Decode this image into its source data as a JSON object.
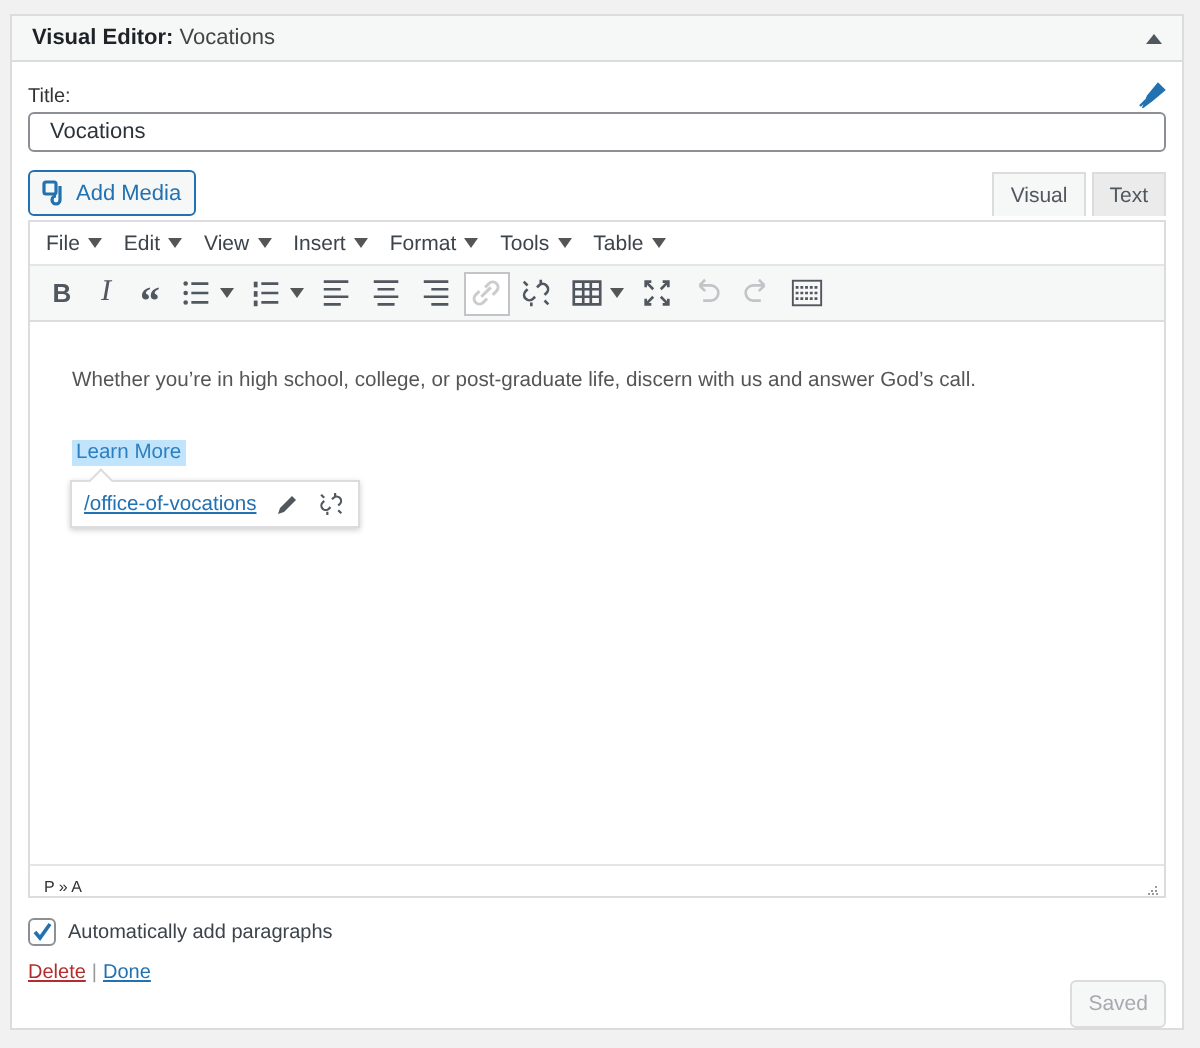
{
  "panel": {
    "title": "**Visual Editor:** Vocations",
    "expanded": true
  },
  "title_field": {
    "label": "Title:",
    "value": "Vocations"
  },
  "add_media": "Add Media",
  "editor_tabs": [
    {
      "label": "Visual",
      "selected": true
    },
    {
      "label": "Text",
      "selected": false
    }
  ],
  "menu": [
    "File",
    "Edit",
    "View",
    "Insert",
    "Format",
    "Tools",
    "Table"
  ],
  "toolbar": [
    {
      "kind": "bold",
      "label": "B",
      "pressed": false,
      "disabled": false
    },
    {
      "kind": "italic",
      "label": "I",
      "pressed": false,
      "disabled": false
    },
    {
      "kind": "quote",
      "label": "“",
      "pressed": false,
      "disabled": false
    },
    {
      "kind": "bullist",
      "pressed": false,
      "disabled": false,
      "dropdown": true
    },
    {
      "kind": "numlist",
      "pressed": false,
      "disabled": false,
      "dropdown": true
    },
    {
      "kind": "alignleft",
      "pressed": false,
      "disabled": false
    },
    {
      "kind": "aligncenter",
      "pressed": false,
      "disabled": false
    },
    {
      "kind": "alignright",
      "pressed": false,
      "disabled": false
    },
    {
      "kind": "link",
      "pressed": true,
      "disabled": false
    },
    {
      "kind": "unlink",
      "pressed": false,
      "disabled": false
    },
    {
      "kind": "table",
      "pressed": false,
      "disabled": false,
      "dropdown": true
    },
    {
      "kind": "fullscreen",
      "pressed": false,
      "disabled": false
    },
    {
      "kind": "undo",
      "pressed": false,
      "disabled": true
    },
    {
      "kind": "redo",
      "pressed": false,
      "disabled": true
    },
    {
      "kind": "kitchensink",
      "pressed": false,
      "disabled": false
    }
  ],
  "content": {
    "paragraph": "Whether you’re in high school, college, or post-graduate life, discern with us and answer God’s call.",
    "link_text": "Learn More",
    "link_selected": true,
    "link_popup": {
      "url": "/office-of-vocations"
    }
  },
  "status_path": "P » A",
  "auto_paragraphs": {
    "label": "Automatically add paragraphs",
    "checked": true
  },
  "delete": "Delete",
  "separator": "|",
  "done": "Done",
  "save_button": {
    "label": "Saved",
    "disabled": true
  }
}
